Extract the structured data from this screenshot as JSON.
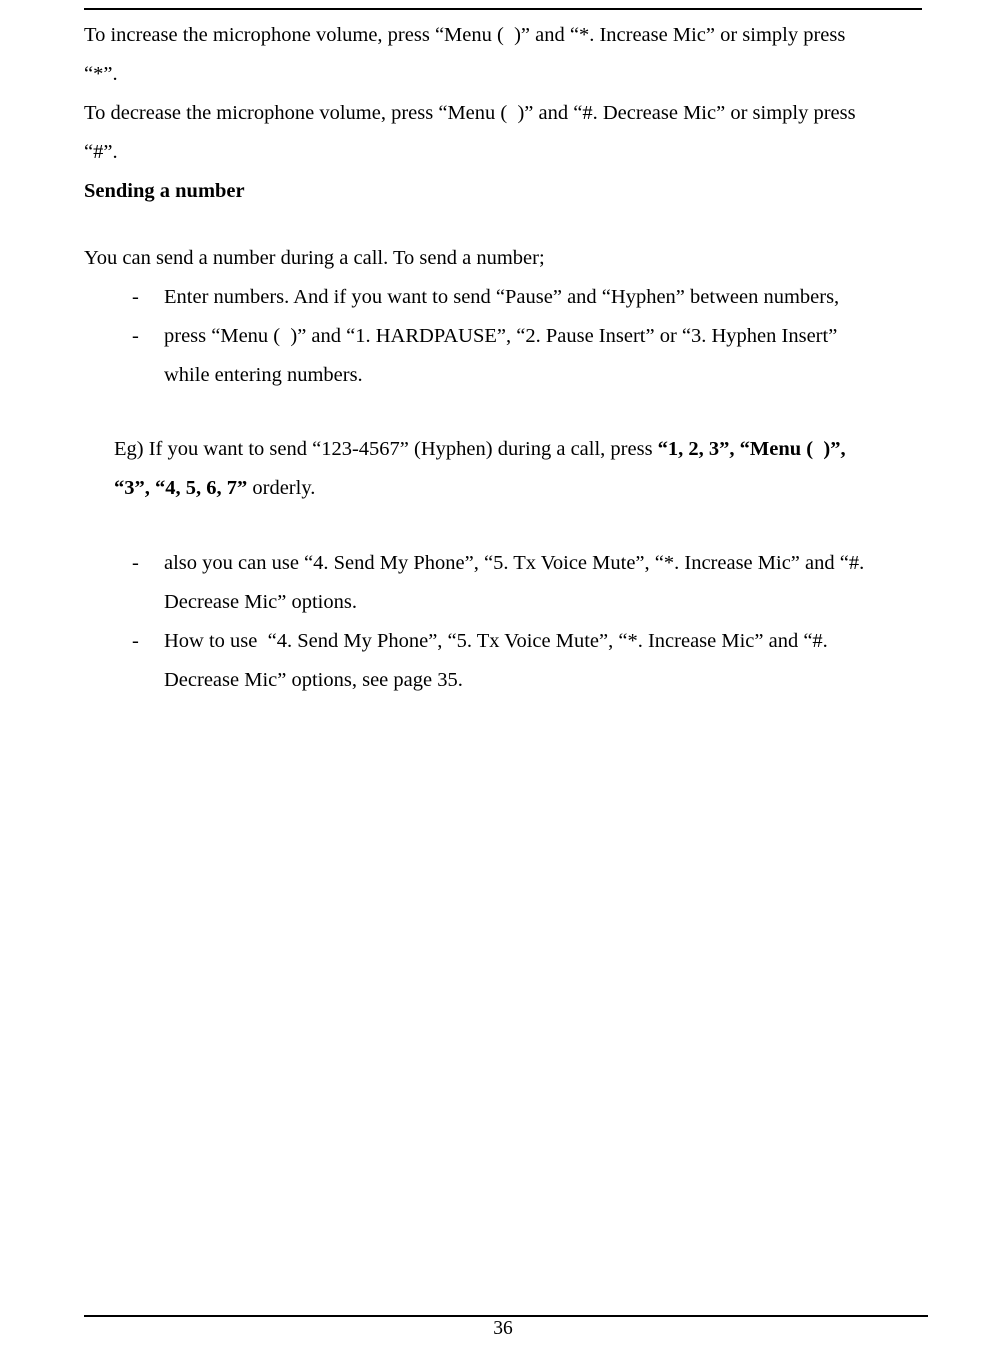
{
  "intro": {
    "line1": "To increase the microphone volume, press “Menu (  )” and “*. Increase Mic” or simply press",
    "line1b": "“*”.",
    "line2": "To decrease the microphone volume, press “Menu (  )” and “#. Decrease Mic” or simply press",
    "line2b": "“#”."
  },
  "section": {
    "title": "Sending a number"
  },
  "body": {
    "lead": "You can send a number during a call. To send a number;",
    "b1": "Enter numbers. And if you want to send “Pause” and “Hyphen” between numbers,",
    "b2": "press “Menu (  )” and “1. HARDPAUSE”, “2. Pause Insert” or “3. Hyphen Insert”",
    "b2c": "while entering numbers.",
    "eg_pre": "Eg) If you want to send “123-4567” (Hyphen) during a call, press ",
    "eg_bold1": "“1, 2, 3”, “Menu (  )”,",
    "eg_bold2": "“3”, “4, 5, 6, 7”",
    "eg_post": " orderly.",
    "b3": "also you can use “4. Send My Phone”, “5. Tx Voice Mute”, “*. Increase Mic” and “#.",
    "b3c": "Decrease Mic” options.",
    "b4": "How to use  “4. Send My Phone”, “5. Tx Voice Mute”, “*. Increase Mic” and “#.",
    "b4c": "Decrease Mic” options, see page 35."
  },
  "pagenum": "36"
}
